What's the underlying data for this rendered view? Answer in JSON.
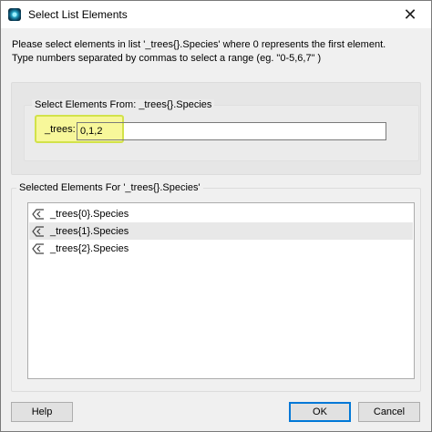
{
  "window": {
    "title": "Select List Elements",
    "close_glyph": "✕"
  },
  "instructions": {
    "line1": "Please select elements in list '_trees{}.Species' where 0 represents the first element.",
    "line2": "Type numbers separated by commas to select a range (eg. \"0-5,6,7\" )"
  },
  "select_group": {
    "legend": "Select Elements From: _trees{}.Species",
    "field_label": "_trees:",
    "field_value": "0,1,2"
  },
  "selected_group": {
    "legend": "Selected Elements For '_trees{}.Species'",
    "items": [
      {
        "label": "_trees{0}.Species",
        "icon": "list-tag-icon"
      },
      {
        "label": "_trees{1}.Species",
        "icon": "list-tag-icon"
      },
      {
        "label": "_trees{2}.Species",
        "icon": "list-tag-icon"
      }
    ]
  },
  "buttons": {
    "help": "Help",
    "ok": "OK",
    "cancel": "Cancel"
  },
  "colors": {
    "highlight_fill": "#f7f79a",
    "highlight_border": "#d2e24a",
    "ok_border": "#0078d7"
  }
}
